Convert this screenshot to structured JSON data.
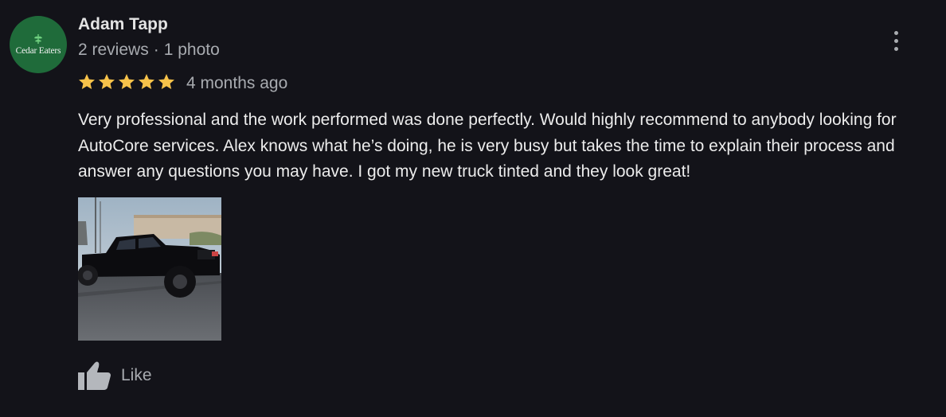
{
  "review": {
    "avatar": {
      "logo_text": "Cedar Eaters",
      "icon": "leaf-icon",
      "background": "#1f6b3a"
    },
    "author_name": "Adam Tapp",
    "reviews_count": "2 reviews",
    "separator": "·",
    "photos_count": "1 photo",
    "rating": 5,
    "time_ago": "4 months ago",
    "text": "Very professional and the work performed was done perfectly. Would highly recommend to anybody looking for AutoCore services. Alex knows what he’s doing, he is very busy but takes the time to explain their process and answer any questions you may have. I got my new truck tinted and they look great!",
    "photo": {
      "subject": "black pickup truck"
    },
    "more_icon": "more-vertical-icon",
    "like": {
      "icon": "thumbs-up-icon",
      "label": "Like"
    }
  },
  "colors": {
    "background": "#131319",
    "star": "#f6c24a",
    "secondary_text": "#a8abb0",
    "primary_text": "#ececec"
  }
}
